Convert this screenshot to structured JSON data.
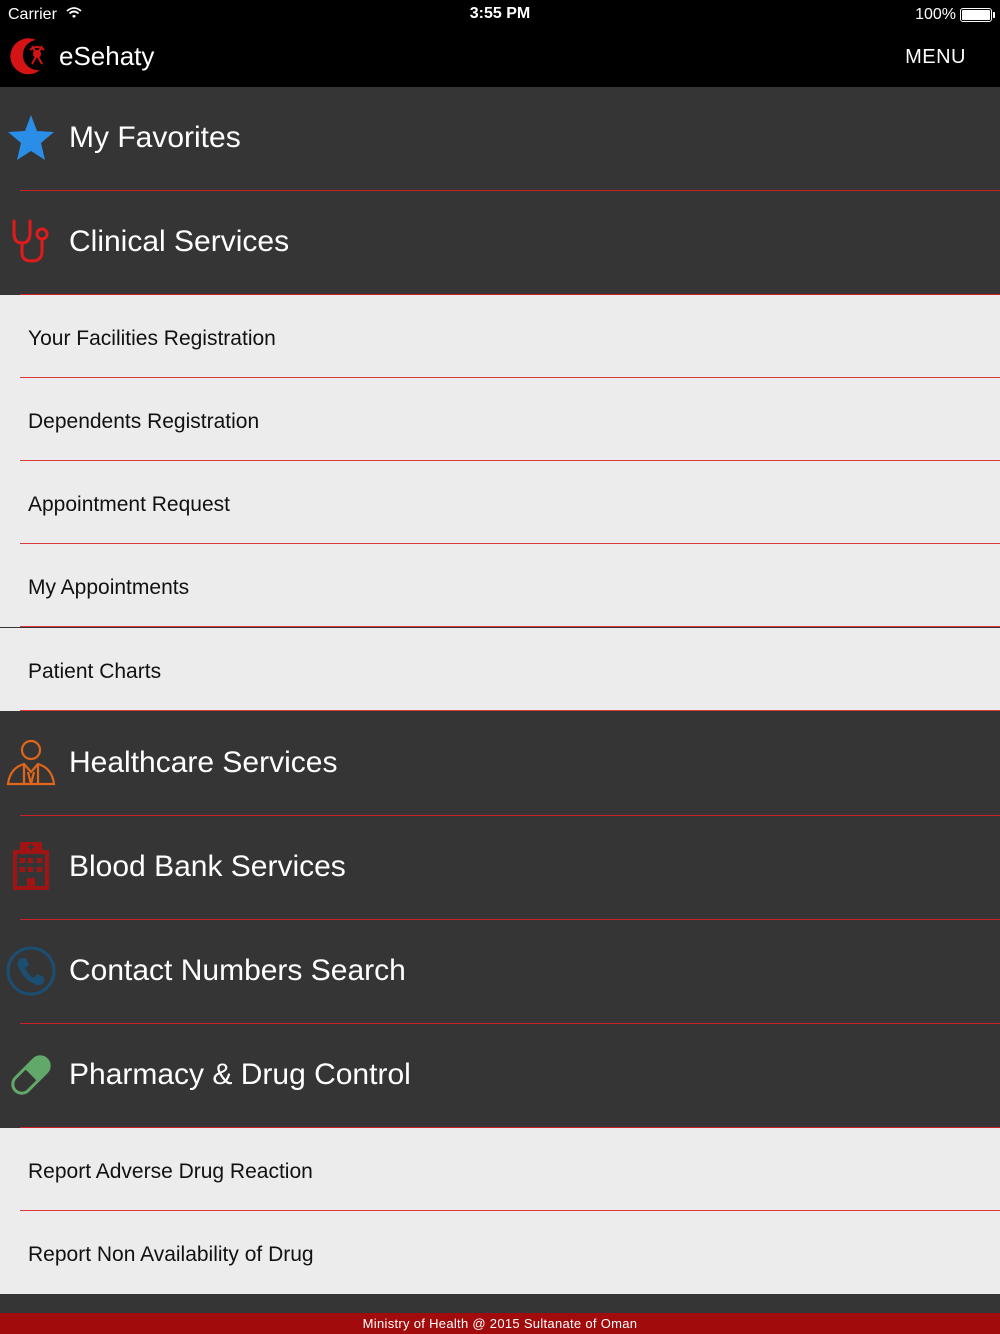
{
  "status_bar": {
    "carrier": "Carrier",
    "time": "3:55 PM",
    "battery": "100%"
  },
  "nav": {
    "title": "eSehaty",
    "menu_label": "MENU"
  },
  "sections": [
    {
      "label": "My Favorites",
      "icon": "star-icon",
      "icon_color": "#2a8de8"
    },
    {
      "label": "Clinical Services",
      "icon": "stethoscope-icon",
      "icon_color": "#e01b1b"
    },
    {
      "label": "Healthcare Services",
      "icon": "doctor-icon",
      "icon_color": "#e0661c"
    },
    {
      "label": "Blood Bank Services",
      "icon": "hospital-building-icon",
      "icon_color": "#a11414"
    },
    {
      "label": "Contact Numbers Search",
      "icon": "phone-icon",
      "icon_color": "#1c4e72"
    },
    {
      "label": "Pharmacy & Drug Control",
      "icon": "pill-icon",
      "icon_color": "#62a86a"
    }
  ],
  "clinical_items": [
    {
      "label": "Your Facilities Registration"
    },
    {
      "label": "Dependents Registration"
    },
    {
      "label": "Appointment Request"
    },
    {
      "label": "My Appointments"
    },
    {
      "label": "Patient Charts"
    }
  ],
  "pharmacy_items": [
    {
      "label": "Report Adverse Drug Reaction"
    },
    {
      "label": "Report Non Availability of Drug"
    }
  ],
  "footer": {
    "text": "Ministry of Health @ 2015 Sultanate of Oman"
  },
  "colors": {
    "section_bg": "#363535",
    "subitem_bg": "#ececec",
    "divider": "#cc1f1f",
    "footer_bg": "#a20b0b"
  }
}
